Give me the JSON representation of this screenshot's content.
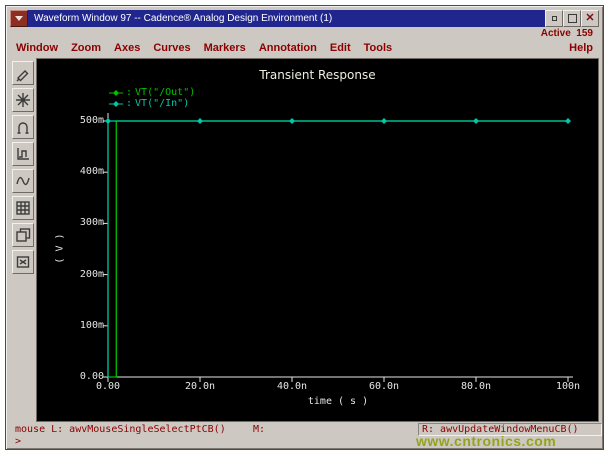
{
  "window": {
    "title": "Waveform Window 97 -- Cadence® Analog Design Environment (1)",
    "controls": [
      "window-menu",
      "minimize",
      "maximize",
      "close"
    ]
  },
  "header": {
    "active_label": "Active  159",
    "help_label": "Help"
  },
  "menus": [
    "Window",
    "Zoom",
    "Axes",
    "Curves",
    "Markers",
    "Annotation",
    "Edit",
    "Tools"
  ],
  "toolbar": {
    "tools": [
      "probe-pen",
      "zoom-star",
      "magnet",
      "strip-chart",
      "waveform",
      "calculator",
      "layers",
      "delete-box"
    ]
  },
  "chart_data": {
    "type": "line",
    "title": "Transient Response",
    "xlabel": "time ( s )",
    "ylabel": "( V )",
    "xlim_ns": [
      0,
      100
    ],
    "ylim_v": [
      0,
      0.5
    ],
    "grid": false,
    "legend_position": "top-left",
    "legend_sep": ":",
    "x_ticks": {
      "values_ns": [
        0,
        20,
        40,
        60,
        80,
        100
      ],
      "labels": [
        "0.00",
        "20.0n",
        "40.0n",
        "60.0n",
        "80.0n",
        "100n"
      ]
    },
    "y_ticks": {
      "values_v": [
        0,
        0.1,
        0.2,
        0.3,
        0.4,
        0.5
      ],
      "labels": [
        "0.00",
        "100m",
        "200m",
        "300m",
        "400m",
        "500m"
      ]
    },
    "series": [
      {
        "name": "VT(\"/Out\")",
        "color": "#00c000",
        "x_ns": [
          0,
          1.8,
          1.8,
          100
        ],
        "y_v": [
          0,
          0,
          0.5,
          0.5
        ],
        "markers_ns": []
      },
      {
        "name": "VT(\"/In\")",
        "color": "#00c8aa",
        "x_ns": [
          0,
          0,
          100
        ],
        "y_v": [
          0,
          0.5,
          0.5
        ],
        "markers_ns": [
          0,
          20,
          40,
          60,
          80,
          100
        ]
      }
    ]
  },
  "statusbar": {
    "left": "mouse L: awvMouseSingleSelectPtCB()",
    "middle": "M:",
    "right": "R: awvUpdateWindowMenuCB()"
  },
  "prompt": ">",
  "watermark": "www.cntronics.com"
}
